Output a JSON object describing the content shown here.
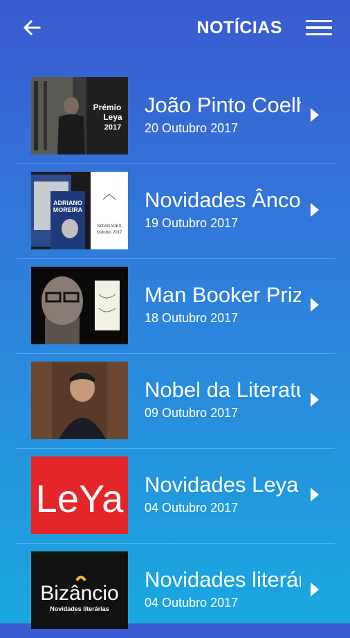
{
  "header": {
    "back_icon": "arrow-left-icon",
    "title": "NOTÍCIAS",
    "menu_icon": "hamburger-menu-icon"
  },
  "news": [
    {
      "title": "João Pinto Coelho",
      "date": "20 Outubro 2017",
      "thumb_text": [
        "Prémio",
        "Leya",
        "2017"
      ]
    },
    {
      "title": "Novidades Âncora",
      "date": "19 Outubro 2017",
      "thumb_text": [
        "ADRIANO",
        "MOREIRA",
        "NOVIDADES",
        "Outubro 2017"
      ]
    },
    {
      "title": "Man Booker Prize",
      "date": "18 Outubro 2017",
      "thumb_text": []
    },
    {
      "title": "Nobel da Literatura",
      "date": "09 Outubro 2017",
      "thumb_text": []
    },
    {
      "title": "Novidades Leya",
      "date": "04 Outubro 2017",
      "thumb_text": [
        "LeYa"
      ]
    },
    {
      "title": "Novidades literárias",
      "date": "04 Outubro 2017",
      "thumb_text": [
        "Bizâncio",
        "Novidades literárias"
      ]
    }
  ]
}
